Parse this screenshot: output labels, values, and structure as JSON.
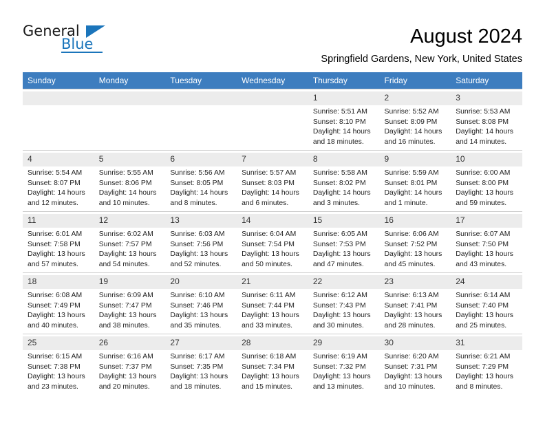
{
  "brand": {
    "name_top": "General",
    "name_bottom": "Blue",
    "triangle_icon": "triangle-icon",
    "accent_color": "#1b75bb"
  },
  "header": {
    "title": "August 2024",
    "subtitle": "Springfield Gardens, New York, United States"
  },
  "calendar": {
    "header_bg": "#3d7dbf",
    "daynum_bg": "#ececec",
    "weekday_headers": [
      "Sunday",
      "Monday",
      "Tuesday",
      "Wednesday",
      "Thursday",
      "Friday",
      "Saturday"
    ],
    "weeks": [
      [
        {
          "day": "",
          "empty": true,
          "sunrise": "",
          "sunset": "",
          "daylight_1": "",
          "daylight_2": ""
        },
        {
          "day": "",
          "empty": true,
          "sunrise": "",
          "sunset": "",
          "daylight_1": "",
          "daylight_2": ""
        },
        {
          "day": "",
          "empty": true,
          "sunrise": "",
          "sunset": "",
          "daylight_1": "",
          "daylight_2": ""
        },
        {
          "day": "",
          "empty": true,
          "sunrise": "",
          "sunset": "",
          "daylight_1": "",
          "daylight_2": ""
        },
        {
          "day": "1",
          "sunrise": "Sunrise: 5:51 AM",
          "sunset": "Sunset: 8:10 PM",
          "daylight_1": "Daylight: 14 hours",
          "daylight_2": "and 18 minutes."
        },
        {
          "day": "2",
          "sunrise": "Sunrise: 5:52 AM",
          "sunset": "Sunset: 8:09 PM",
          "daylight_1": "Daylight: 14 hours",
          "daylight_2": "and 16 minutes."
        },
        {
          "day": "3",
          "sunrise": "Sunrise: 5:53 AM",
          "sunset": "Sunset: 8:08 PM",
          "daylight_1": "Daylight: 14 hours",
          "daylight_2": "and 14 minutes."
        }
      ],
      [
        {
          "day": "4",
          "sunrise": "Sunrise: 5:54 AM",
          "sunset": "Sunset: 8:07 PM",
          "daylight_1": "Daylight: 14 hours",
          "daylight_2": "and 12 minutes."
        },
        {
          "day": "5",
          "sunrise": "Sunrise: 5:55 AM",
          "sunset": "Sunset: 8:06 PM",
          "daylight_1": "Daylight: 14 hours",
          "daylight_2": "and 10 minutes."
        },
        {
          "day": "6",
          "sunrise": "Sunrise: 5:56 AM",
          "sunset": "Sunset: 8:05 PM",
          "daylight_1": "Daylight: 14 hours",
          "daylight_2": "and 8 minutes."
        },
        {
          "day": "7",
          "sunrise": "Sunrise: 5:57 AM",
          "sunset": "Sunset: 8:03 PM",
          "daylight_1": "Daylight: 14 hours",
          "daylight_2": "and 6 minutes."
        },
        {
          "day": "8",
          "sunrise": "Sunrise: 5:58 AM",
          "sunset": "Sunset: 8:02 PM",
          "daylight_1": "Daylight: 14 hours",
          "daylight_2": "and 3 minutes."
        },
        {
          "day": "9",
          "sunrise": "Sunrise: 5:59 AM",
          "sunset": "Sunset: 8:01 PM",
          "daylight_1": "Daylight: 14 hours",
          "daylight_2": "and 1 minute."
        },
        {
          "day": "10",
          "sunrise": "Sunrise: 6:00 AM",
          "sunset": "Sunset: 8:00 PM",
          "daylight_1": "Daylight: 13 hours",
          "daylight_2": "and 59 minutes."
        }
      ],
      [
        {
          "day": "11",
          "sunrise": "Sunrise: 6:01 AM",
          "sunset": "Sunset: 7:58 PM",
          "daylight_1": "Daylight: 13 hours",
          "daylight_2": "and 57 minutes."
        },
        {
          "day": "12",
          "sunrise": "Sunrise: 6:02 AM",
          "sunset": "Sunset: 7:57 PM",
          "daylight_1": "Daylight: 13 hours",
          "daylight_2": "and 54 minutes."
        },
        {
          "day": "13",
          "sunrise": "Sunrise: 6:03 AM",
          "sunset": "Sunset: 7:56 PM",
          "daylight_1": "Daylight: 13 hours",
          "daylight_2": "and 52 minutes."
        },
        {
          "day": "14",
          "sunrise": "Sunrise: 6:04 AM",
          "sunset": "Sunset: 7:54 PM",
          "daylight_1": "Daylight: 13 hours",
          "daylight_2": "and 50 minutes."
        },
        {
          "day": "15",
          "sunrise": "Sunrise: 6:05 AM",
          "sunset": "Sunset: 7:53 PM",
          "daylight_1": "Daylight: 13 hours",
          "daylight_2": "and 47 minutes."
        },
        {
          "day": "16",
          "sunrise": "Sunrise: 6:06 AM",
          "sunset": "Sunset: 7:52 PM",
          "daylight_1": "Daylight: 13 hours",
          "daylight_2": "and 45 minutes."
        },
        {
          "day": "17",
          "sunrise": "Sunrise: 6:07 AM",
          "sunset": "Sunset: 7:50 PM",
          "daylight_1": "Daylight: 13 hours",
          "daylight_2": "and 43 minutes."
        }
      ],
      [
        {
          "day": "18",
          "sunrise": "Sunrise: 6:08 AM",
          "sunset": "Sunset: 7:49 PM",
          "daylight_1": "Daylight: 13 hours",
          "daylight_2": "and 40 minutes."
        },
        {
          "day": "19",
          "sunrise": "Sunrise: 6:09 AM",
          "sunset": "Sunset: 7:47 PM",
          "daylight_1": "Daylight: 13 hours",
          "daylight_2": "and 38 minutes."
        },
        {
          "day": "20",
          "sunrise": "Sunrise: 6:10 AM",
          "sunset": "Sunset: 7:46 PM",
          "daylight_1": "Daylight: 13 hours",
          "daylight_2": "and 35 minutes."
        },
        {
          "day": "21",
          "sunrise": "Sunrise: 6:11 AM",
          "sunset": "Sunset: 7:44 PM",
          "daylight_1": "Daylight: 13 hours",
          "daylight_2": "and 33 minutes."
        },
        {
          "day": "22",
          "sunrise": "Sunrise: 6:12 AM",
          "sunset": "Sunset: 7:43 PM",
          "daylight_1": "Daylight: 13 hours",
          "daylight_2": "and 30 minutes."
        },
        {
          "day": "23",
          "sunrise": "Sunrise: 6:13 AM",
          "sunset": "Sunset: 7:41 PM",
          "daylight_1": "Daylight: 13 hours",
          "daylight_2": "and 28 minutes."
        },
        {
          "day": "24",
          "sunrise": "Sunrise: 6:14 AM",
          "sunset": "Sunset: 7:40 PM",
          "daylight_1": "Daylight: 13 hours",
          "daylight_2": "and 25 minutes."
        }
      ],
      [
        {
          "day": "25",
          "sunrise": "Sunrise: 6:15 AM",
          "sunset": "Sunset: 7:38 PM",
          "daylight_1": "Daylight: 13 hours",
          "daylight_2": "and 23 minutes."
        },
        {
          "day": "26",
          "sunrise": "Sunrise: 6:16 AM",
          "sunset": "Sunset: 7:37 PM",
          "daylight_1": "Daylight: 13 hours",
          "daylight_2": "and 20 minutes."
        },
        {
          "day": "27",
          "sunrise": "Sunrise: 6:17 AM",
          "sunset": "Sunset: 7:35 PM",
          "daylight_1": "Daylight: 13 hours",
          "daylight_2": "and 18 minutes."
        },
        {
          "day": "28",
          "sunrise": "Sunrise: 6:18 AM",
          "sunset": "Sunset: 7:34 PM",
          "daylight_1": "Daylight: 13 hours",
          "daylight_2": "and 15 minutes."
        },
        {
          "day": "29",
          "sunrise": "Sunrise: 6:19 AM",
          "sunset": "Sunset: 7:32 PM",
          "daylight_1": "Daylight: 13 hours",
          "daylight_2": "and 13 minutes."
        },
        {
          "day": "30",
          "sunrise": "Sunrise: 6:20 AM",
          "sunset": "Sunset: 7:31 PM",
          "daylight_1": "Daylight: 13 hours",
          "daylight_2": "and 10 minutes."
        },
        {
          "day": "31",
          "sunrise": "Sunrise: 6:21 AM",
          "sunset": "Sunset: 7:29 PM",
          "daylight_1": "Daylight: 13 hours",
          "daylight_2": "and 8 minutes."
        }
      ]
    ]
  }
}
